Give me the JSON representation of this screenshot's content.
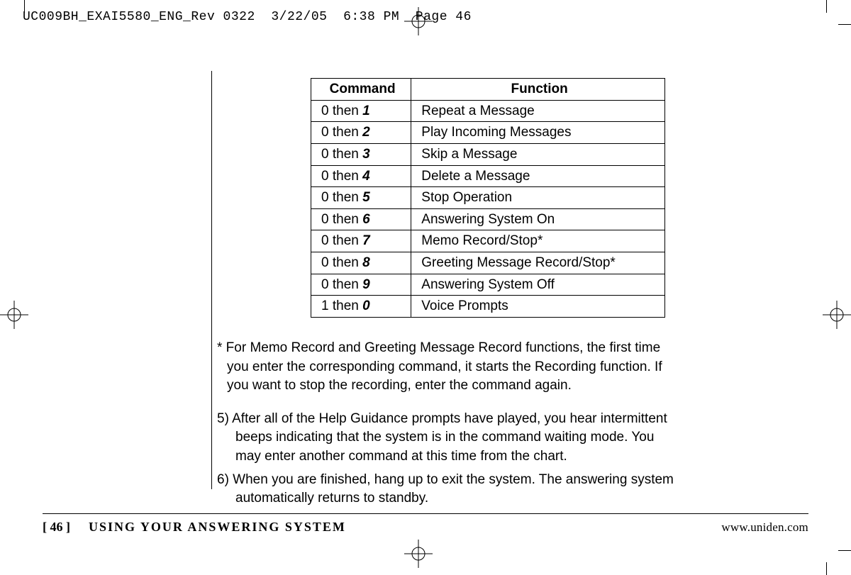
{
  "slug": "UC009BH_EXAI5580_ENG_Rev 0322  3/22/05  6:38 PM  Page 46",
  "table": {
    "headers": {
      "command": "Command",
      "function": "Function"
    },
    "rows": [
      {
        "prefix": "0 then ",
        "key": "1",
        "function": "Repeat a Message"
      },
      {
        "prefix": "0 then ",
        "key": "2",
        "function": "Play Incoming Messages"
      },
      {
        "prefix": "0 then ",
        "key": "3",
        "function": "Skip a Message"
      },
      {
        "prefix": "0 then ",
        "key": "4",
        "function": "Delete a Message"
      },
      {
        "prefix": "0 then ",
        "key": "5",
        "function": "Stop Operation"
      },
      {
        "prefix": "0 then ",
        "key": "6",
        "function": "Answering System On"
      },
      {
        "prefix": "0 then ",
        "key": "7",
        "function": "Memo Record/Stop*"
      },
      {
        "prefix": "0 then ",
        "key": "8",
        "function": "Greeting Message Record/Stop*"
      },
      {
        "prefix": "0 then ",
        "key": "9",
        "function": "Answering System Off"
      },
      {
        "prefix": "1 then ",
        "key": "0",
        "function": "Voice Prompts"
      }
    ]
  },
  "footnote": "* For Memo Record and Greeting Message Record functions, the first time you enter the corresponding command, it starts the Recording function. If you want to stop the recording, enter the command again.",
  "steps": {
    "s5": "5) After all of the Help Guidance prompts have played, you hear intermittent beeps indicating that the system is in the command waiting mode. You may enter another command at this time from the chart.",
    "s6": "6) When you are finished, hang up to exit the system. The answering system automatically returns to standby."
  },
  "footer": {
    "page": "[ 46 ]",
    "section": "USING YOUR ANSWERING SYSTEM",
    "url": "www.uniden.com"
  }
}
